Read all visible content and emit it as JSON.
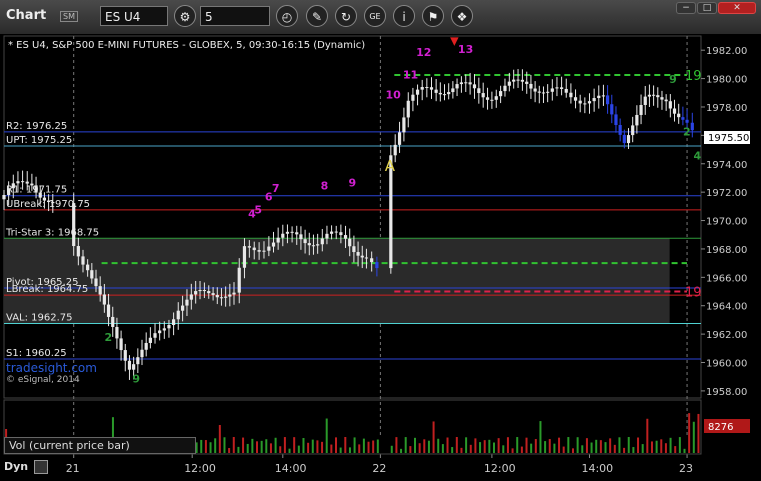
{
  "toolbar": {
    "title": "Chart",
    "link_badge": "SM",
    "symbol": "ES U4",
    "interval": "5"
  },
  "window_buttons": [
    "−",
    "□",
    "✕"
  ],
  "chart_data": {
    "type": "candlestick",
    "title": "* ES U4, S&P 500 E-MINI FUTURES - GLOBEX, 5, 09:30-16:15 (Dynamic)",
    "ylim": [
      1957.5,
      1983.0
    ],
    "y_ticks": [
      "1982.00",
      "1980.00",
      "1978.00",
      "1976.00",
      "1974.00",
      "1972.00",
      "1970.00",
      "1968.00",
      "1966.00",
      "1964.00",
      "1962.00",
      "1960.00",
      "1958.00"
    ],
    "x_ticks": [
      "21",
      "12:00",
      "14:00",
      "22",
      "12:00",
      "14:00",
      "23"
    ],
    "last_price": "1975.50",
    "volume_value": "8276",
    "volume_label": "Vol (current price bar)",
    "footer_mode": "Dyn",
    "watermark": "tradesight.com",
    "copyright": "© eSignal, 2014",
    "levels": [
      {
        "label": "R2: 1976.25",
        "value": 1976.25,
        "color": "#2b44d6"
      },
      {
        "label": "UPT: 1975.25",
        "value": 1975.25,
        "color": "#4aa3c8"
      },
      {
        "label": "R1: 1971.75",
        "value": 1971.75,
        "color": "#2b44d6"
      },
      {
        "label": "UBreak: 1970.75",
        "value": 1970.75,
        "color": "#cc2020"
      },
      {
        "label": "Tri-Star 3: 1968.75",
        "value": 1968.75,
        "color": "#2e9a3a"
      },
      {
        "label": "Pivot: 1965.25",
        "value": 1965.25,
        "color": "#2b44d6"
      },
      {
        "label": "LBreak: 1964.75",
        "value": 1964.75,
        "color": "#cc2020"
      },
      {
        "label": "VAL: 1962.75",
        "value": 1962.75,
        "color": "#4fd2d2"
      },
      {
        "label": "S1: 1960.25",
        "value": 1960.25,
        "color": "#2b44d6"
      }
    ],
    "dashed_levels": [
      {
        "value": 1980.25,
        "color": "#31c431",
        "label": "19",
        "start_x": 0.56
      },
      {
        "value": 1965.0,
        "color": "#e0204a",
        "label": "19",
        "start_x": 0.56
      },
      {
        "value": 1967.0,
        "color": "#31c431",
        "label": "",
        "start_x": 0.14
      }
    ],
    "value_area": {
      "low": 1962.75,
      "high": 1968.75
    },
    "annotations": [
      {
        "text": "A",
        "x": 0.552,
        "value": 1973.5,
        "color": "#e0d04a"
      },
      {
        "text": "10",
        "x": 0.553,
        "value": 1978.6,
        "color": "#d020d0"
      },
      {
        "text": "11",
        "x": 0.578,
        "value": 1980.0,
        "color": "#d020d0"
      },
      {
        "text": "12",
        "x": 0.597,
        "value": 1981.6,
        "color": "#d020d0"
      },
      {
        "text": "13",
        "x": 0.657,
        "value": 1981.8,
        "color": "#d020d0"
      },
      {
        "text": "4",
        "x": 0.356,
        "value": 1970.2,
        "color": "#d020d0"
      },
      {
        "text": "5",
        "x": 0.365,
        "value": 1970.5,
        "color": "#d020d0"
      },
      {
        "text": "6",
        "x": 0.38,
        "value": 1971.4,
        "color": "#d020d0"
      },
      {
        "text": "7",
        "x": 0.39,
        "value": 1972.0,
        "color": "#d020d0"
      },
      {
        "text": "8",
        "x": 0.46,
        "value": 1972.2,
        "color": "#d020d0"
      },
      {
        "text": "9",
        "x": 0.5,
        "value": 1972.4,
        "color": "#d020d0"
      },
      {
        "text": "2",
        "x": 0.15,
        "value": 1961.5,
        "color": "#2e9a3a"
      },
      {
        "text": "9",
        "x": 0.19,
        "value": 1958.6,
        "color": "#2e9a3a"
      },
      {
        "text": "9",
        "x": 0.96,
        "value": 1979.7,
        "color": "#2e9a3a"
      },
      {
        "text": "2",
        "x": 0.98,
        "value": 1976.0,
        "color": "#2e9a3a"
      },
      {
        "text": "4",
        "x": 0.995,
        "value": 1974.3,
        "color": "#2e9a3a"
      }
    ]
  }
}
